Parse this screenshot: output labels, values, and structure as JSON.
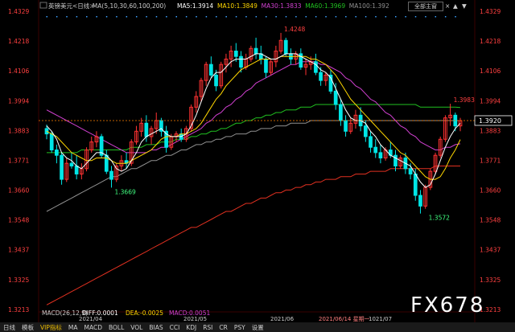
{
  "header": {
    "symbol_name": "英镑美元<日线>",
    "ma_params": "MA(5,10,30,60,100,200)",
    "ma5": "MA5:1.3914",
    "ma10": "MA10:1.3849",
    "ma30": "MA30:1.3833",
    "ma60": "MA60:1.3969",
    "ma100": "MA100:1.392",
    "main_button": "全部主窗"
  },
  "colors": {
    "up": "#ff3232",
    "down": "#00e6e6",
    "ma5": "#ffffff",
    "ma10": "#ffd700",
    "ma30": "#d040d0",
    "ma60": "#20c020",
    "ma100": "#909090",
    "ma200": "#e03020",
    "axis_text": "#ff4040",
    "last_price": "#ff8000",
    "background": "#000000"
  },
  "macd": {
    "label": "MACD(26,12,9)",
    "diff": "DIFF:0.0001",
    "dea": "DEA:-0.0025",
    "macd": "MACD:0.0051"
  },
  "annotations": {
    "high": "1.4248",
    "low1": "1.3669",
    "low2": "1.3572",
    "right": "1.3983",
    "last": "1.3920",
    "watermark": "FX678"
  },
  "chart_data": {
    "type": "candlestick",
    "y_ticks": [
      "1.4329",
      "1.4218",
      "1.4106",
      "1.3994",
      "1.3883",
      "1.3771",
      "1.3660",
      "1.3548",
      "1.3437",
      "1.3325",
      "1.3213"
    ],
    "ylim": [
      1.3213,
      1.4329
    ],
    "x_labels": [
      "2021/04",
      "2021/05",
      "2021/06",
      "2021/06/14 星期一",
      "1021/07"
    ],
    "candles": [
      [
        1.389,
        1.3905,
        1.385,
        1.387
      ],
      [
        1.387,
        1.388,
        1.38,
        1.381
      ],
      [
        1.381,
        1.383,
        1.376,
        1.379
      ],
      [
        1.379,
        1.38,
        1.368,
        1.37
      ],
      [
        1.37,
        1.378,
        1.369,
        1.376
      ],
      [
        1.376,
        1.38,
        1.374,
        1.375
      ],
      [
        1.375,
        1.379,
        1.37,
        1.372
      ],
      [
        1.372,
        1.376,
        1.37,
        1.374
      ],
      [
        1.374,
        1.382,
        1.373,
        1.381
      ],
      [
        1.381,
        1.386,
        1.38,
        1.384
      ],
      [
        1.384,
        1.388,
        1.382,
        1.386
      ],
      [
        1.386,
        1.387,
        1.378,
        1.379
      ],
      [
        1.379,
        1.381,
        1.372,
        1.373
      ],
      [
        1.373,
        1.375,
        1.3669,
        1.37
      ],
      [
        1.37,
        1.376,
        1.369,
        1.375
      ],
      [
        1.375,
        1.379,
        1.373,
        1.377
      ],
      [
        1.377,
        1.38,
        1.374,
        1.376
      ],
      [
        1.376,
        1.385,
        1.375,
        1.384
      ],
      [
        1.384,
        1.39,
        1.383,
        1.388
      ],
      [
        1.388,
        1.393,
        1.386,
        1.391
      ],
      [
        1.391,
        1.394,
        1.384,
        1.386
      ],
      [
        1.386,
        1.39,
        1.383,
        1.389
      ],
      [
        1.389,
        1.395,
        1.387,
        1.392
      ],
      [
        1.392,
        1.393,
        1.386,
        1.388
      ],
      [
        1.388,
        1.39,
        1.38,
        1.382
      ],
      [
        1.382,
        1.387,
        1.381,
        1.386
      ],
      [
        1.386,
        1.388,
        1.384,
        1.387
      ],
      [
        1.387,
        1.389,
        1.384,
        1.385
      ],
      [
        1.385,
        1.39,
        1.384,
        1.389
      ],
      [
        1.389,
        1.398,
        1.388,
        1.397
      ],
      [
        1.397,
        1.403,
        1.395,
        1.401
      ],
      [
        1.401,
        1.408,
        1.399,
        1.407
      ],
      [
        1.407,
        1.414,
        1.405,
        1.413
      ],
      [
        1.413,
        1.416,
        1.408,
        1.409
      ],
      [
        1.409,
        1.411,
        1.403,
        1.405
      ],
      [
        1.405,
        1.414,
        1.404,
        1.413
      ],
      [
        1.413,
        1.417,
        1.41,
        1.415
      ],
      [
        1.415,
        1.42,
        1.412,
        1.418
      ],
      [
        1.418,
        1.421,
        1.414,
        1.416
      ],
      [
        1.416,
        1.418,
        1.41,
        1.412
      ],
      [
        1.412,
        1.417,
        1.411,
        1.415
      ],
      [
        1.415,
        1.42,
        1.414,
        1.419
      ],
      [
        1.419,
        1.423,
        1.415,
        1.417
      ],
      [
        1.417,
        1.42,
        1.413,
        1.415
      ],
      [
        1.415,
        1.416,
        1.408,
        1.41
      ],
      [
        1.41,
        1.415,
        1.409,
        1.414
      ],
      [
        1.414,
        1.42,
        1.412,
        1.418
      ],
      [
        1.418,
        1.4248,
        1.417,
        1.422
      ],
      [
        1.422,
        1.423,
        1.416,
        1.417
      ],
      [
        1.417,
        1.419,
        1.413,
        1.415
      ],
      [
        1.415,
        1.418,
        1.413,
        1.417
      ],
      [
        1.417,
        1.419,
        1.411,
        1.412
      ],
      [
        1.412,
        1.415,
        1.409,
        1.413
      ],
      [
        1.413,
        1.416,
        1.411,
        1.414
      ],
      [
        1.414,
        1.417,
        1.409,
        1.41
      ],
      [
        1.41,
        1.412,
        1.405,
        1.407
      ],
      [
        1.407,
        1.41,
        1.405,
        1.409
      ],
      [
        1.409,
        1.411,
        1.402,
        1.403
      ],
      [
        1.403,
        1.406,
        1.396,
        1.398
      ],
      [
        1.398,
        1.4,
        1.39,
        1.392
      ],
      [
        1.392,
        1.394,
        1.386,
        1.388
      ],
      [
        1.388,
        1.393,
        1.387,
        1.391
      ],
      [
        1.391,
        1.396,
        1.389,
        1.394
      ],
      [
        1.394,
        1.397,
        1.388,
        1.39
      ],
      [
        1.39,
        1.392,
        1.384,
        1.386
      ],
      [
        1.386,
        1.388,
        1.38,
        1.382
      ],
      [
        1.382,
        1.385,
        1.378,
        1.38
      ],
      [
        1.38,
        1.383,
        1.376,
        1.378
      ],
      [
        1.378,
        1.382,
        1.377,
        1.381
      ],
      [
        1.381,
        1.384,
        1.378,
        1.379
      ],
      [
        1.379,
        1.381,
        1.373,
        1.375
      ],
      [
        1.375,
        1.379,
        1.374,
        1.378
      ],
      [
        1.378,
        1.38,
        1.372,
        1.374
      ],
      [
        1.374,
        1.376,
        1.37,
        1.372
      ],
      [
        1.372,
        1.374,
        1.362,
        1.364
      ],
      [
        1.364,
        1.366,
        1.3572,
        1.36
      ],
      [
        1.36,
        1.368,
        1.359,
        1.367
      ],
      [
        1.367,
        1.374,
        1.366,
        1.373
      ],
      [
        1.373,
        1.38,
        1.372,
        1.379
      ],
      [
        1.379,
        1.386,
        1.378,
        1.385
      ],
      [
        1.385,
        1.394,
        1.384,
        1.393
      ],
      [
        1.393,
        1.3983,
        1.39,
        1.394
      ],
      [
        1.394,
        1.395,
        1.388,
        1.39
      ],
      [
        1.39,
        1.393,
        1.388,
        1.392
      ]
    ],
    "ma5": [
      1.39,
      1.388,
      1.385,
      1.38,
      1.378,
      1.377,
      1.375,
      1.374,
      1.376,
      1.378,
      1.38,
      1.38,
      1.379,
      1.377,
      1.374,
      1.373,
      1.374,
      1.377,
      1.38,
      1.384,
      1.386,
      1.387,
      1.388,
      1.389,
      1.387,
      1.386,
      1.386,
      1.386,
      1.387,
      1.39,
      1.394,
      1.399,
      1.404,
      1.408,
      1.41,
      1.41,
      1.412,
      1.414,
      1.415,
      1.415,
      1.415,
      1.416,
      1.417,
      1.417,
      1.416,
      1.415,
      1.415,
      1.416,
      1.417,
      1.417,
      1.417,
      1.416,
      1.415,
      1.414,
      1.413,
      1.411,
      1.41,
      1.408,
      1.404,
      1.4,
      1.396,
      1.393,
      1.392,
      1.392,
      1.391,
      1.388,
      1.386,
      1.383,
      1.381,
      1.379,
      1.378,
      1.377,
      1.376,
      1.375,
      1.372,
      1.369,
      1.367,
      1.368,
      1.372,
      1.377,
      1.382,
      1.386,
      1.389,
      1.391
    ],
    "ma10": [
      1.388,
      1.387,
      1.386,
      1.384,
      1.382,
      1.38,
      1.379,
      1.378,
      1.377,
      1.377,
      1.378,
      1.378,
      1.378,
      1.377,
      1.376,
      1.376,
      1.376,
      1.377,
      1.378,
      1.379,
      1.38,
      1.381,
      1.383,
      1.385,
      1.386,
      1.386,
      1.386,
      1.387,
      1.387,
      1.388,
      1.389,
      1.391,
      1.394,
      1.397,
      1.4,
      1.402,
      1.405,
      1.407,
      1.409,
      1.411,
      1.412,
      1.413,
      1.414,
      1.415,
      1.415,
      1.415,
      1.415,
      1.416,
      1.416,
      1.416,
      1.416,
      1.416,
      1.416,
      1.415,
      1.415,
      1.414,
      1.413,
      1.411,
      1.409,
      1.406,
      1.403,
      1.4,
      1.398,
      1.396,
      1.394,
      1.392,
      1.39,
      1.388,
      1.386,
      1.384,
      1.382,
      1.38,
      1.379,
      1.377,
      1.375,
      1.373,
      1.371,
      1.37,
      1.37,
      1.371,
      1.374,
      1.378,
      1.381,
      1.3849
    ],
    "ma30": [
      1.396,
      1.395,
      1.394,
      1.393,
      1.392,
      1.391,
      1.39,
      1.389,
      1.388,
      1.387,
      1.386,
      1.385,
      1.384,
      1.383,
      1.382,
      1.381,
      1.38,
      1.38,
      1.38,
      1.38,
      1.38,
      1.381,
      1.381,
      1.382,
      1.382,
      1.383,
      1.384,
      1.385,
      1.386,
      1.387,
      1.388,
      1.389,
      1.391,
      1.392,
      1.394,
      1.395,
      1.397,
      1.398,
      1.4,
      1.401,
      1.403,
      1.404,
      1.406,
      1.407,
      1.408,
      1.409,
      1.41,
      1.411,
      1.412,
      1.413,
      1.413,
      1.414,
      1.414,
      1.414,
      1.414,
      1.413,
      1.413,
      1.412,
      1.411,
      1.41,
      1.408,
      1.407,
      1.405,
      1.404,
      1.402,
      1.4,
      1.399,
      1.397,
      1.395,
      1.394,
      1.392,
      1.39,
      1.389,
      1.387,
      1.386,
      1.384,
      1.383,
      1.382,
      1.381,
      1.381,
      1.382,
      1.382,
      1.383,
      1.3833
    ],
    "ma60": [
      1.38,
      1.38,
      1.38,
      1.38,
      1.38,
      1.38,
      1.38,
      1.381,
      1.381,
      1.381,
      1.381,
      1.381,
      1.381,
      1.381,
      1.381,
      1.381,
      1.381,
      1.382,
      1.382,
      1.382,
      1.383,
      1.383,
      1.383,
      1.384,
      1.384,
      1.384,
      1.385,
      1.385,
      1.385,
      1.386,
      1.386,
      1.387,
      1.387,
      1.388,
      1.388,
      1.389,
      1.389,
      1.39,
      1.391,
      1.391,
      1.392,
      1.392,
      1.393,
      1.393,
      1.394,
      1.394,
      1.395,
      1.395,
      1.396,
      1.396,
      1.396,
      1.397,
      1.397,
      1.397,
      1.398,
      1.398,
      1.398,
      1.398,
      1.398,
      1.398,
      1.398,
      1.398,
      1.398,
      1.398,
      1.398,
      1.398,
      1.398,
      1.398,
      1.398,
      1.398,
      1.398,
      1.398,
      1.398,
      1.398,
      1.398,
      1.397,
      1.397,
      1.397,
      1.397,
      1.397,
      1.397,
      1.397,
      1.397,
      1.3969
    ],
    "ma100": [
      1.358,
      1.359,
      1.36,
      1.361,
      1.362,
      1.363,
      1.364,
      1.365,
      1.366,
      1.367,
      1.368,
      1.369,
      1.37,
      1.371,
      1.371,
      1.372,
      1.373,
      1.374,
      1.374,
      1.375,
      1.376,
      1.377,
      1.377,
      1.378,
      1.379,
      1.379,
      1.38,
      1.381,
      1.381,
      1.382,
      1.383,
      1.383,
      1.384,
      1.384,
      1.385,
      1.385,
      1.386,
      1.386,
      1.387,
      1.387,
      1.387,
      1.388,
      1.388,
      1.389,
      1.389,
      1.389,
      1.39,
      1.39,
      1.39,
      1.391,
      1.391,
      1.391,
      1.391,
      1.392,
      1.392,
      1.392,
      1.392,
      1.392,
      1.392,
      1.392,
      1.392,
      1.392,
      1.392,
      1.392,
      1.392,
      1.392,
      1.392,
      1.392,
      1.392,
      1.392,
      1.392,
      1.392,
      1.392,
      1.392,
      1.392,
      1.392,
      1.392,
      1.392,
      1.392,
      1.392,
      1.392,
      1.392,
      1.392,
      1.392
    ],
    "ma200": [
      1.323,
      1.324,
      1.325,
      1.326,
      1.327,
      1.328,
      1.329,
      1.33,
      1.331,
      1.332,
      1.333,
      1.334,
      1.335,
      1.336,
      1.337,
      1.338,
      1.339,
      1.34,
      1.341,
      1.342,
      1.343,
      1.344,
      1.345,
      1.346,
      1.347,
      1.348,
      1.349,
      1.35,
      1.351,
      1.352,
      1.352,
      1.353,
      1.354,
      1.355,
      1.356,
      1.357,
      1.358,
      1.358,
      1.359,
      1.36,
      1.361,
      1.361,
      1.362,
      1.363,
      1.363,
      1.364,
      1.365,
      1.365,
      1.366,
      1.366,
      1.367,
      1.367,
      1.368,
      1.368,
      1.369,
      1.369,
      1.37,
      1.37,
      1.37,
      1.371,
      1.371,
      1.371,
      1.372,
      1.372,
      1.372,
      1.373,
      1.373,
      1.373,
      1.373,
      1.374,
      1.374,
      1.374,
      1.374,
      1.374,
      1.374,
      1.374,
      1.374,
      1.374,
      1.375,
      1.375,
      1.375,
      1.375,
      1.375,
      1.375
    ]
  },
  "tabs": [
    "日线",
    "模板",
    "VIP指标",
    "MA",
    "MACD",
    "BOLL",
    "VOL",
    "BIAS",
    "CCI",
    "KDJ",
    "RSI",
    "CR",
    "PSY",
    "设置"
  ]
}
